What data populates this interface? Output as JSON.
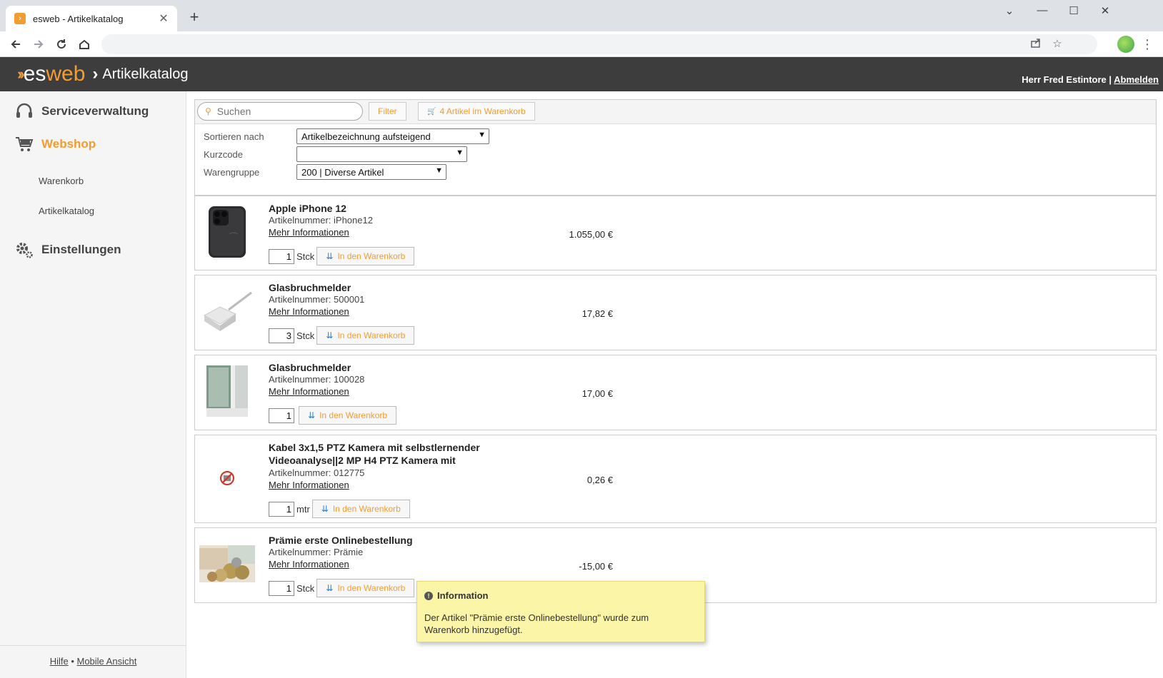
{
  "browser": {
    "tab_title": "esweb - Artikelkatalog",
    "tab_close": "✕",
    "new_tab": "+",
    "win_min": "⌄",
    "win_minimize": "—",
    "win_maximize": "☐",
    "win_close": "✕"
  },
  "header": {
    "logo_es": "es",
    "logo_web": "web",
    "separator": "›",
    "page_title": "Artikelkatalog",
    "user_name": "Herr Fred Estintore",
    "user_sep": " | ",
    "logout": "Abmelden"
  },
  "sidebar": {
    "items": [
      {
        "label": "Serviceverwaltung"
      },
      {
        "label": "Webshop"
      },
      {
        "label": "Einstellungen"
      }
    ],
    "subitems": [
      {
        "label": "Warenkorb"
      },
      {
        "label": "Artikelkatalog"
      }
    ],
    "footer": {
      "help": "Hilfe",
      "dot": " • ",
      "mobile": "Mobile Ansicht"
    }
  },
  "filters": {
    "search_placeholder": "Suchen",
    "filter_button": "Filter",
    "cart_button": "4 Artikel im Warenkorb",
    "sort_label": "Sortieren nach",
    "sort_value": "Artikelbezeichnung aufsteigend",
    "shortcode_label": "Kurzcode",
    "shortcode_value": "",
    "group_label": "Warengruppe",
    "group_value": "200 | Diverse Artikel"
  },
  "labels": {
    "more_info": "Mehr Informationen",
    "add_to_cart": "In den Warenkorb"
  },
  "products": [
    {
      "name": "Apple iPhone 12",
      "number": "Artikelnummer: iPhone12",
      "price": "1.055,00 €",
      "qty": "1",
      "unit": "Stck"
    },
    {
      "name": "Glasbruchmelder",
      "number": "Artikelnummer: 500001",
      "price": "17,82 €",
      "qty": "3",
      "unit": "Stck"
    },
    {
      "name": "Glasbruchmelder",
      "number": "Artikelnummer: 100028",
      "price": "17,00 €",
      "qty": "1",
      "unit": ""
    },
    {
      "name": "Kabel 3x1,5 PTZ Kamera mit selbstlernender Videoanalyse||2 MP H4 PTZ Kamera mit",
      "number": "Artikelnummer: 012775",
      "price": "0,26 €",
      "qty": "1",
      "unit": "mtr"
    },
    {
      "name": "Prämie erste Onlinebestellung",
      "number": "Artikelnummer: Prämie",
      "price": "-15,00 €",
      "qty": "1",
      "unit": "Stck"
    }
  ],
  "toast": {
    "title": "Information",
    "text": "Der Artikel \"Prämie erste Onlinebestellung\" wurde zum Warenkorb hinzugefügt."
  },
  "colors": {
    "accent": "#f39c32",
    "header_bg": "#3d3d3d",
    "toast_bg": "#fbf5a8"
  },
  "icons": {
    "back": "arrow-left-icon",
    "forward": "arrow-right-icon",
    "reload": "reload-icon",
    "home": "home-icon",
    "share": "share-icon",
    "star": "star-icon",
    "headset": "headset-icon",
    "cart": "cart-icon",
    "gear": "gear-icon"
  }
}
